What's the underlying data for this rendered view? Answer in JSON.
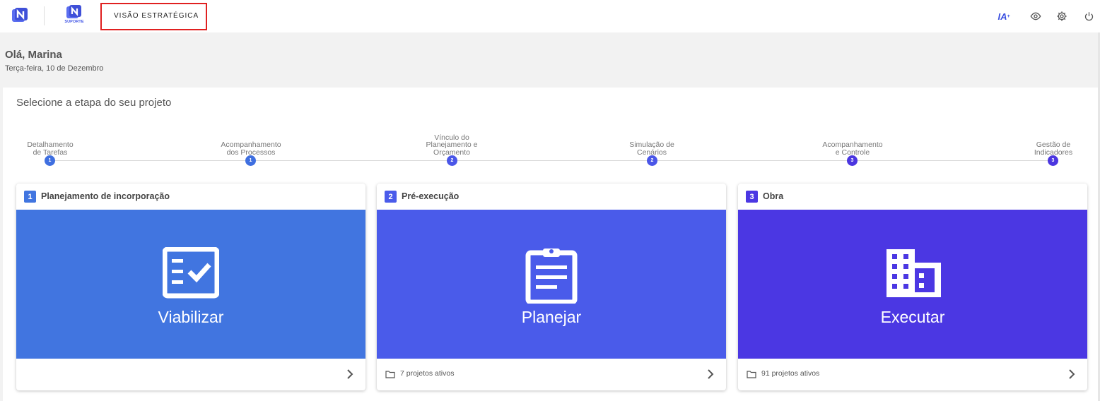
{
  "header": {
    "nav_tab_label": "VISÃO ESTRATÉGICA",
    "suporte_label": "SUPORTE",
    "ia_label": "IA",
    "ia_sup": "+",
    "actions": [
      {
        "icon": "ia-icon"
      },
      {
        "icon": "eye-icon"
      },
      {
        "icon": "gear-icon"
      },
      {
        "icon": "power-icon"
      }
    ]
  },
  "greeting": {
    "title": "Olá, Marina",
    "date": "Terça-feira, 10 de Dezembro"
  },
  "panel": {
    "title": "Selecione a etapa do seu projeto"
  },
  "steps": [
    {
      "label": "Detalhamento de Tarefas",
      "line1": "Detalhamento",
      "line2": "de Tarefas",
      "line3": "",
      "num": "1"
    },
    {
      "label": "Acompanhamento dos Processos",
      "line1": "Acompanhamento",
      "line2": "dos Processos",
      "line3": "",
      "num": "1"
    },
    {
      "label": "Vínculo do Planejamento e Orçamento",
      "line1": "Vínculo do",
      "line2": "Planejamento e",
      "line3": "Orçamento",
      "num": "2"
    },
    {
      "label": "Simulação de Cenários",
      "line1": "Simulação de",
      "line2": "Cenários",
      "line3": "",
      "num": "2"
    },
    {
      "label": "Acompanhamento e Controle",
      "line1": "Acompanhamento",
      "line2": "e Controle",
      "line3": "",
      "num": "3"
    },
    {
      "label": "Gestão de Indicadores",
      "line1": "Gestão de",
      "line2": "Indicadores",
      "line3": "",
      "num": "3"
    }
  ],
  "step_colors": {
    "1": "#3f6fe0",
    "2": "#4a56e8",
    "3": "#4b36e0"
  },
  "cards": [
    {
      "num": "1",
      "title": "Planejamento de incorporação",
      "action": "Viabilizar",
      "icon": "checklist-icon",
      "footer": "",
      "color": "#4175e0"
    },
    {
      "num": "2",
      "title": "Pré-execução",
      "action": "Planejar",
      "icon": "clipboard-icon",
      "footer": "7 projetos ativos",
      "color": "#4a5bea"
    },
    {
      "num": "3",
      "title": "Obra",
      "action": "Executar",
      "icon": "building-icon",
      "footer": "91 projetos ativos",
      "color": "#4b37e3"
    }
  ]
}
